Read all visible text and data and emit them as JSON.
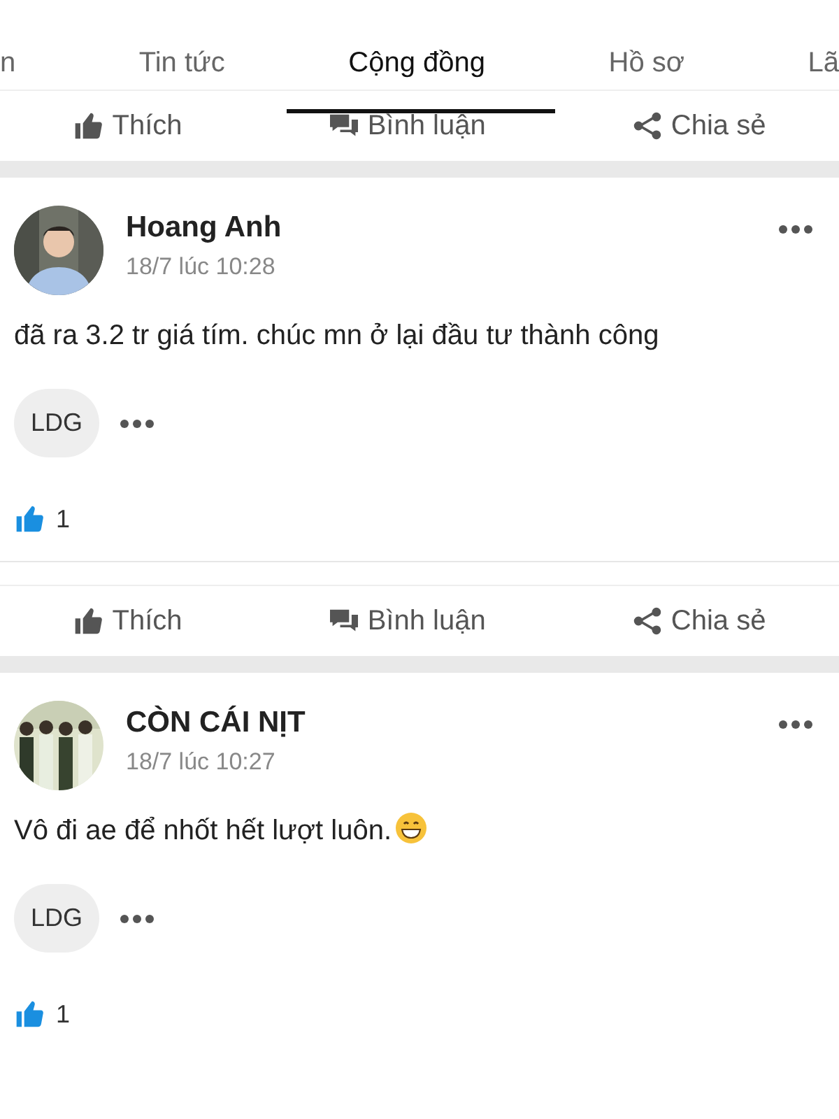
{
  "tabs": [
    {
      "label": "n",
      "selected": false
    },
    {
      "label": "Tin tức",
      "selected": false
    },
    {
      "label": "Cộng đồng",
      "selected": true
    },
    {
      "label": "Hồ sơ",
      "selected": false
    },
    {
      "label": "Lã",
      "selected": false
    }
  ],
  "top_actions": [
    "Thích",
    "Bình luận",
    "Chia sẻ"
  ],
  "posts": [
    {
      "author": "Hoang Anh",
      "time": "18/7 lúc 10:28",
      "text": "đã ra 3.2 tr giá tím. chúc mn ở lại đầu tư thành công",
      "emoji": false,
      "tag": "LDG",
      "likes": "1",
      "actions": [
        "Thích",
        "Bình luận",
        "Chia sẻ"
      ]
    },
    {
      "author": "CÒN CÁI NỊT",
      "time": "18/7 lúc 10:27",
      "text": "Vô đi ae để nhốt hết lượt luôn.",
      "emoji": true,
      "tag": "LDG",
      "likes": "1"
    }
  ]
}
